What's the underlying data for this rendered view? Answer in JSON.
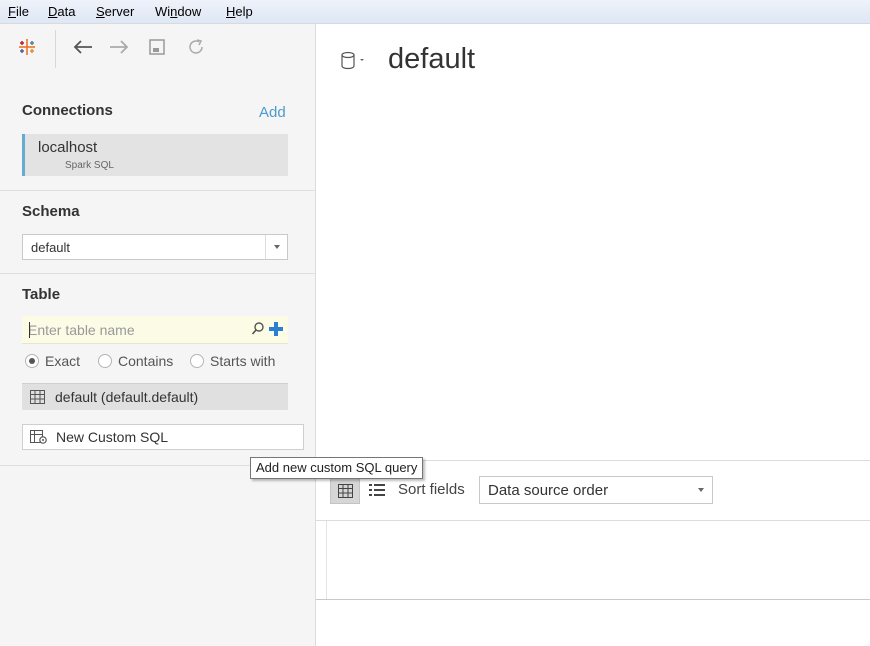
{
  "menu": {
    "items": [
      {
        "label": "File",
        "accel": "F",
        "rest": "ile"
      },
      {
        "label": "Data",
        "accel": "D",
        "rest": "ata"
      },
      {
        "label": "Server",
        "accel": "S",
        "rest": "erver"
      },
      {
        "label": "Window",
        "pre": "Wi",
        "accel": "n",
        "rest": "dow"
      },
      {
        "label": "Help",
        "accel": "H",
        "rest": "elp"
      }
    ]
  },
  "toolbar": {
    "icons": [
      "tableau-logo-icon",
      "back-arrow-icon",
      "forward-arrow-icon",
      "save-icon",
      "refresh-icon"
    ]
  },
  "connections": {
    "title": "Connections",
    "add_label": "Add",
    "items": [
      {
        "name": "localhost",
        "type": "Spark SQL"
      }
    ]
  },
  "schema": {
    "title": "Schema",
    "selected": "default"
  },
  "table": {
    "title": "Table",
    "search_placeholder": "Enter table name",
    "match_options": [
      "Exact",
      "Contains",
      "Starts with"
    ],
    "selected_match": "Exact",
    "items": [
      {
        "label": "default (default.default)"
      }
    ],
    "custom_sql_label": "New Custom SQL"
  },
  "tooltip": {
    "text": "Add new custom SQL query"
  },
  "main": {
    "datasource_title": "default",
    "sort_label": "Sort fields",
    "sort_selected": "Data source order"
  },
  "colors": {
    "accent": "#67a9cf",
    "link": "#4a9bd0",
    "add_plus": "#2a7fd4"
  }
}
